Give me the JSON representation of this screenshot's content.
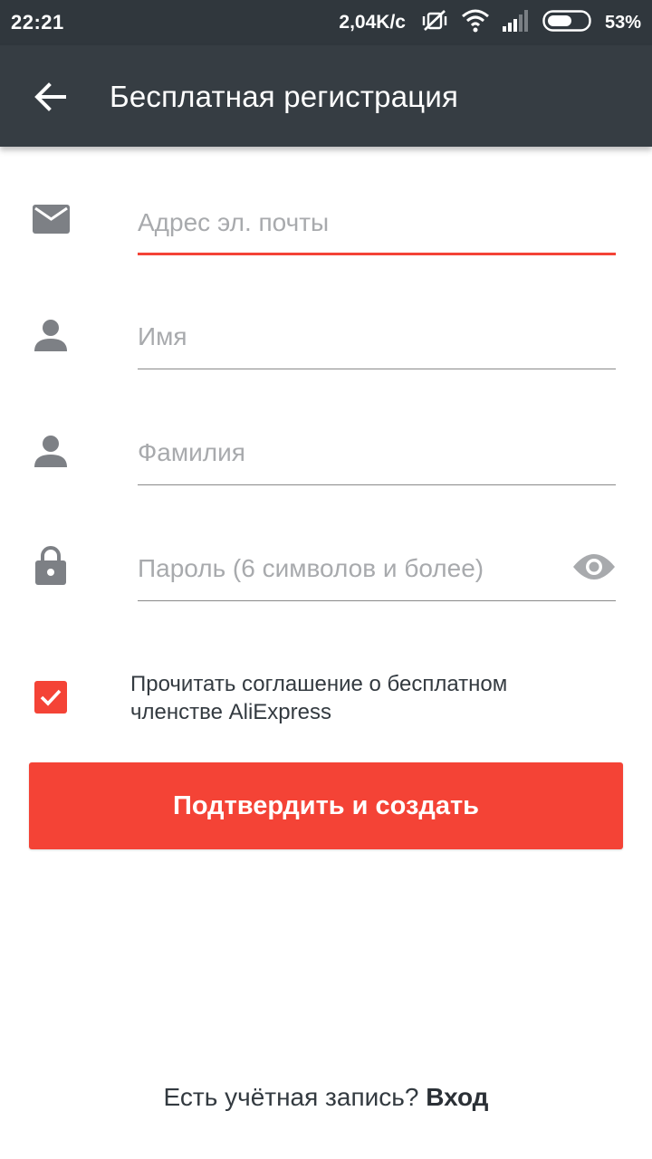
{
  "status_bar": {
    "time": "22:21",
    "network_speed": "2,04K/с",
    "battery_percent": "53%",
    "icons": [
      "mute-vibrate-icon",
      "wifi-icon",
      "signal-icon",
      "battery-icon"
    ]
  },
  "app_bar": {
    "back_icon": "arrow-left-icon",
    "title": "Бесплатная регистрация",
    "background_color": "#363d43"
  },
  "form": {
    "email": {
      "placeholder": "Адрес эл. почты",
      "value": "",
      "icon": "mail-icon",
      "active": true
    },
    "first_name": {
      "placeholder": "Имя",
      "value": "",
      "icon": "person-icon"
    },
    "last_name": {
      "placeholder": "Фамилия",
      "value": "",
      "icon": "person-icon"
    },
    "password": {
      "placeholder": "Пароль (6 символов и более)",
      "value": "",
      "icon": "lock-icon",
      "toggle_icon": "eye-icon"
    }
  },
  "agreement": {
    "checked": true,
    "text": "Прочитать соглашение о бесплатном членстве AliExpress"
  },
  "submit": {
    "label": "Подтвердить и создать"
  },
  "footer": {
    "question": "Есть учётная запись? ",
    "login_label": "Вход"
  },
  "colors": {
    "accent": "#f44336",
    "icon_gray": "#7d8085",
    "text_dark": "#333a40"
  }
}
